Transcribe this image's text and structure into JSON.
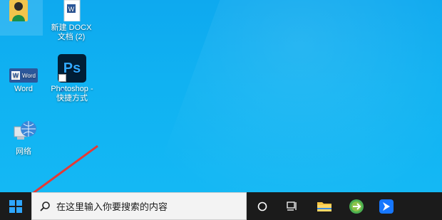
{
  "desktop": {
    "icons": [
      {
        "label": "",
        "icon": "user-folder-icon"
      },
      {
        "label": "新建 DOCX\n文档 (2)",
        "icon": "word-document-icon"
      },
      {
        "label": "Word",
        "icon": "word-app-icon",
        "badge": "Word"
      },
      {
        "label": "Photoshop -\n快捷方式",
        "icon": "photoshop-icon",
        "badge": "Ps"
      },
      {
        "label": "网络",
        "icon": "network-icon"
      }
    ]
  },
  "taskbar": {
    "search_placeholder": "在这里输入你要搜索的内容",
    "icons": [
      "start-windows-icon",
      "search-icon",
      "cortana-icon",
      "task-view-icon",
      "file-explorer-icon",
      "browser-icon",
      "feishu-icon"
    ]
  },
  "colors": {
    "desktop": "#0ea9ef",
    "taskbar": "#1b1b1b",
    "search_bg": "#f3f3f3",
    "arrow": "#e53935"
  }
}
